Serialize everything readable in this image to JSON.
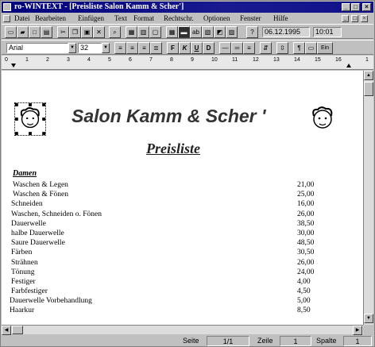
{
  "window": {
    "title": "ro-WINTEXT - [Preisliste Salon Kamm & Scher']",
    "controls": [
      "_",
      "□",
      "×"
    ]
  },
  "menu": {
    "items": [
      "Datei",
      "Bearbeiten",
      "Einfügen",
      "Text",
      "Format",
      "Rechtschr.",
      "Optionen",
      "Fenster",
      "Hilfe"
    ],
    "doc_controls": [
      "_",
      "□",
      "×"
    ]
  },
  "toolbar": {
    "date": "06.12.1995",
    "time": "10:01"
  },
  "format_bar": {
    "font": "Arial",
    "size": "32",
    "btn_bold": "F",
    "btn_italic": "K",
    "btn_underline": "U",
    "btn_strike": "D",
    "btn_last": "Ein"
  },
  "ruler": {
    "ticks": [
      "0",
      "1",
      "2",
      "3",
      "4",
      "5",
      "6",
      "7",
      "8",
      "9",
      "10",
      "11",
      "12",
      "13",
      "14",
      "15",
      "16",
      "1"
    ]
  },
  "document": {
    "heading": "Salon Kamm & Scher '",
    "subheading": "Preisliste",
    "section": "Damen",
    "rows": [
      {
        "name": "Waschen & Legen",
        "price": "21,00"
      },
      {
        "name": "Waschen & Fönen",
        "price": "25,00"
      },
      {
        "name": "Schneiden",
        "price": "16,00"
      },
      {
        "name": "Waschen, Schneiden o. Fönen",
        "price": "26,00"
      },
      {
        "name": "Dauerwelle",
        "price": "38,50"
      },
      {
        "name": "halbe Dauerwelle",
        "price": "30,00"
      },
      {
        "name": "Saure Dauerwelle",
        "price": "48,50"
      },
      {
        "name": "Färben",
        "price": "30,50"
      },
      {
        "name": "Strähnen",
        "price": "26,00"
      },
      {
        "name": "Tönung",
        "price": "24,00"
      },
      {
        "name": "Festiger",
        "price": "4,00"
      },
      {
        "name": "Farbfestiger",
        "price": "4,50"
      },
      {
        "name": "Dauerwelle Vorbehandlung",
        "price": "5,00"
      },
      {
        "name": "Haarkur",
        "price": "8,50"
      }
    ]
  },
  "status": {
    "page_label": "Seite",
    "page_value": "1/1",
    "line_label": "Zeile",
    "line_value": "1",
    "col_label": "Spalte",
    "col_value": "1"
  }
}
